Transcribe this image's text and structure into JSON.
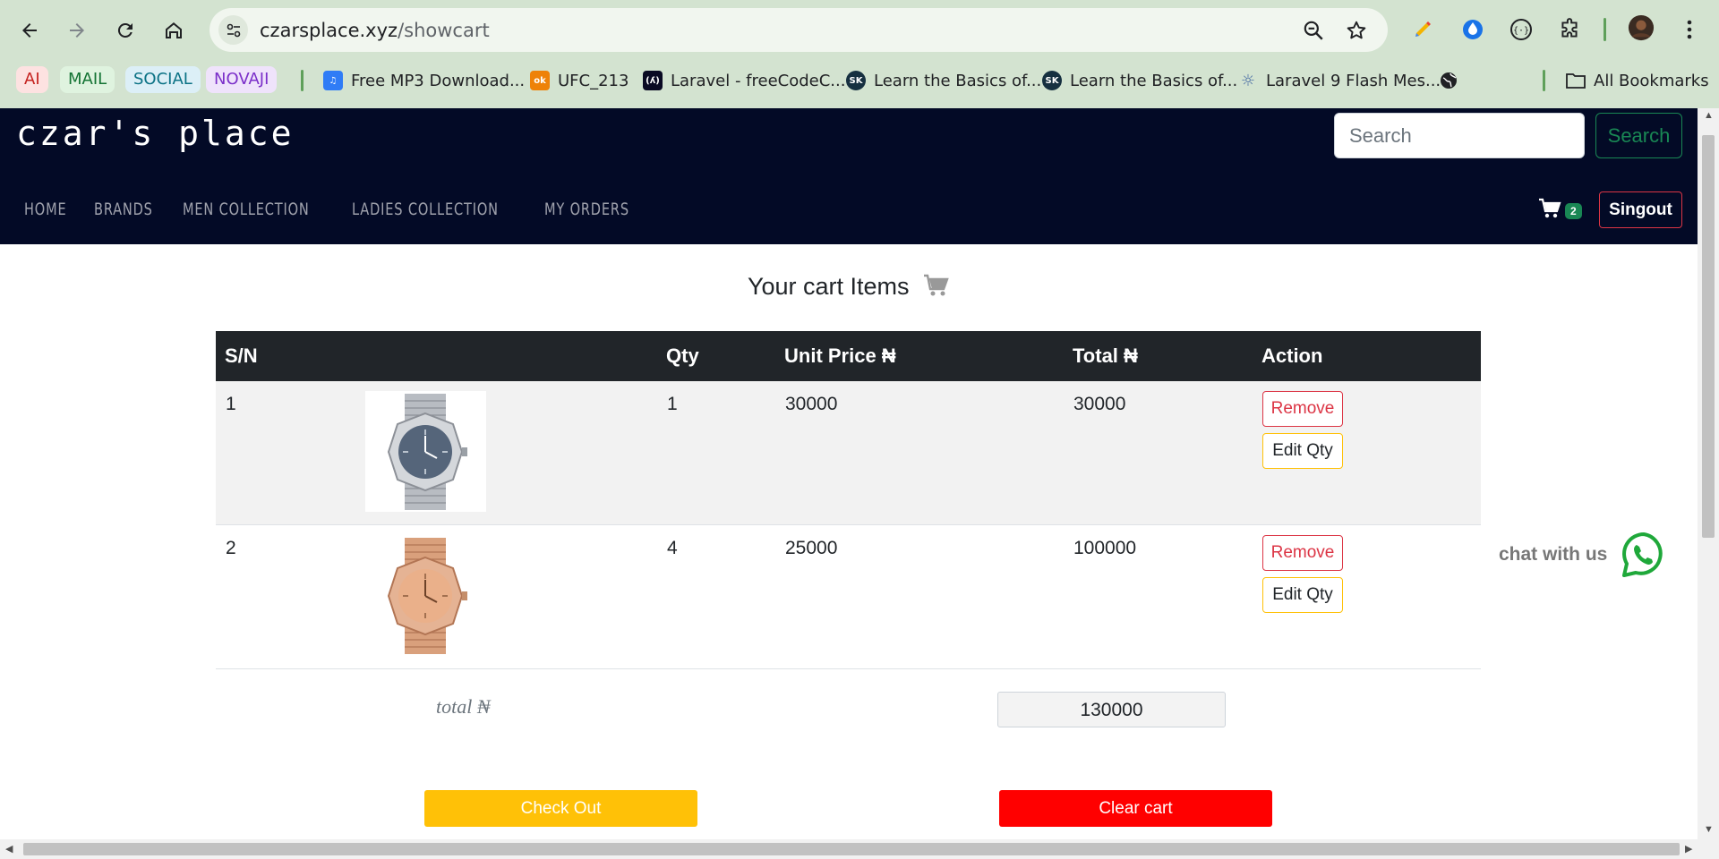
{
  "browser": {
    "url_domain": "czarsplace.xyz",
    "url_path": "/showcart",
    "chips": [
      {
        "label": "AI",
        "bg": "#fde2e1",
        "color": "#c5221f"
      },
      {
        "label": "MAIL",
        "bg": "#dff3df",
        "color": "#137333"
      },
      {
        "label": "SOCIAL",
        "bg": "#dceff7",
        "color": "#0b7285"
      },
      {
        "label": "NOVAJI",
        "bg": "#efe3fb",
        "color": "#7b2fc9"
      }
    ],
    "bookmarks": [
      {
        "label": "Free MP3 Download...",
        "icon": "music-icon"
      },
      {
        "label": "UFC_213",
        "icon": "ok-icon"
      },
      {
        "label": "Laravel - freeCodeC...",
        "icon": "freecodecamp-icon"
      },
      {
        "label": "Learn the Basics of...",
        "icon": "sk-icon"
      },
      {
        "label": "Learn the Basics of...",
        "icon": "sk-icon"
      },
      {
        "label": "Laravel 9 Flash Mes...",
        "icon": "bulb-icon"
      }
    ],
    "all_bookmarks": "All Bookmarks"
  },
  "site": {
    "brand": "czar's place",
    "search_placeholder": "Search",
    "search_button": "Search",
    "menu": [
      "HOME",
      "BRANDS",
      "MEN COLLECTION",
      "LADIES COLLECTION",
      "MY ORDERS"
    ],
    "cart_count": "2",
    "signout": "Singout"
  },
  "cart": {
    "heading": "Your cart Items",
    "columns": {
      "sn": "S/N",
      "qty": "Qty",
      "unit": "Unit Price ₦",
      "total": "Total ₦",
      "action": "Action"
    },
    "items": [
      {
        "sn": "1",
        "qty": "1",
        "unit_price": "30000",
        "total": "30000",
        "remove": "Remove",
        "edit": "Edit Qty"
      },
      {
        "sn": "2",
        "qty": "4",
        "unit_price": "25000",
        "total": "100000",
        "remove": "Remove",
        "edit": "Edit Qty"
      }
    ],
    "total_label": "total ₦",
    "total_value": "130000",
    "checkout": "Check Out",
    "clear": "Clear cart"
  },
  "chat": {
    "label": "chat with us"
  }
}
